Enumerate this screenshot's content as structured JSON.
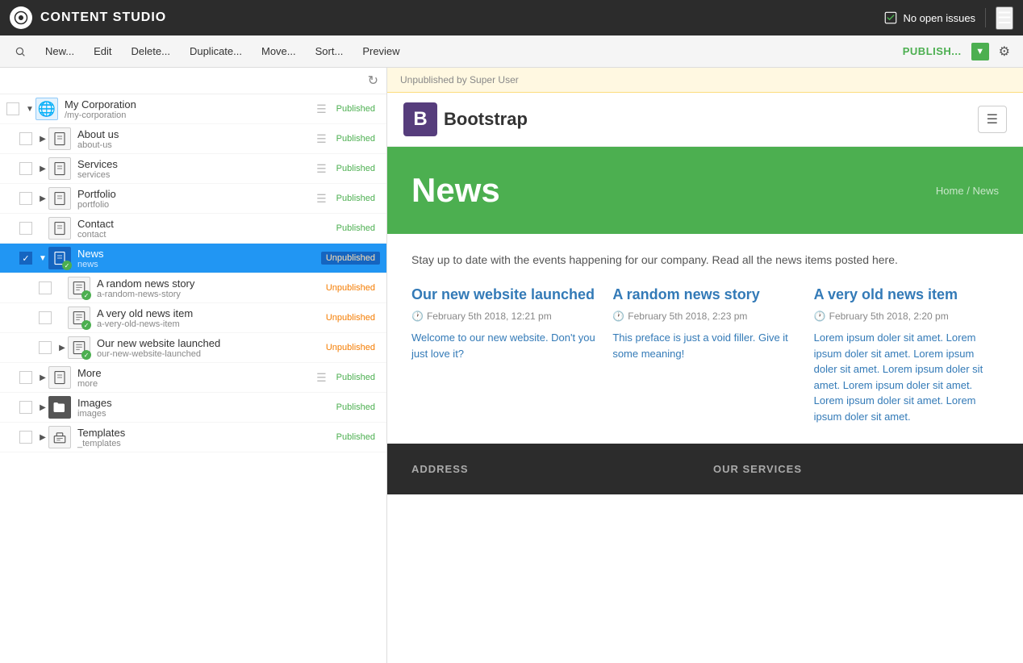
{
  "topbar": {
    "title": "CONTENT STUDIO",
    "no_issues_label": "No open issues"
  },
  "toolbar": {
    "new_label": "New...",
    "edit_label": "Edit",
    "delete_label": "Delete...",
    "duplicate_label": "Duplicate...",
    "move_label": "Move...",
    "sort_label": "Sort...",
    "preview_label": "Preview",
    "publish_label": "PUBLISH..."
  },
  "sidebar": {
    "items": [
      {
        "id": "my-corporation",
        "name": "My Corporation",
        "path": "/my-corporation",
        "icon": "globe",
        "status": "Published",
        "status_class": "published",
        "indent": 0,
        "has_expand": true,
        "expanded": true
      },
      {
        "id": "about-us",
        "name": "About us",
        "path": "about-us",
        "icon": "page",
        "status": "Published",
        "status_class": "published",
        "indent": 1,
        "has_expand": true
      },
      {
        "id": "services",
        "name": "Services",
        "path": "services",
        "icon": "page",
        "status": "Published",
        "status_class": "published",
        "indent": 1,
        "has_expand": true
      },
      {
        "id": "portfolio",
        "name": "Portfolio",
        "path": "portfolio",
        "icon": "page",
        "status": "Published",
        "status_class": "published",
        "indent": 1,
        "has_expand": true
      },
      {
        "id": "contact",
        "name": "Contact",
        "path": "contact",
        "icon": "page",
        "status": "Published",
        "status_class": "published",
        "indent": 1,
        "has_expand": false
      },
      {
        "id": "news",
        "name": "News",
        "path": "news",
        "icon": "page",
        "status": "Unpublished",
        "status_class": "unpublished",
        "indent": 1,
        "has_expand": true,
        "selected": true
      },
      {
        "id": "a-random-news-story",
        "name": "A random news story",
        "path": "a-random-news-story",
        "icon": "article",
        "status": "Unpublished",
        "status_class": "unpublished",
        "indent": 2,
        "has_expand": false,
        "has_check": true
      },
      {
        "id": "a-very-old-news-item",
        "name": "A very old news item",
        "path": "a-very-old-news-item",
        "icon": "article",
        "status": "Unpublished",
        "status_class": "unpublished",
        "indent": 2,
        "has_expand": false,
        "has_check": true
      },
      {
        "id": "our-new-website-launched",
        "name": "Our new website launched",
        "path": "our-new-website-launched",
        "icon": "article",
        "status": "Unpublished",
        "status_class": "unpublished",
        "indent": 2,
        "has_expand": true,
        "has_check": true
      },
      {
        "id": "more",
        "name": "More",
        "path": "more",
        "icon": "page",
        "status": "Published",
        "status_class": "published",
        "indent": 1,
        "has_expand": true
      },
      {
        "id": "images",
        "name": "Images",
        "path": "images",
        "icon": "folder",
        "status": "Published",
        "status_class": "published",
        "indent": 1,
        "has_expand": true
      },
      {
        "id": "templates",
        "name": "Templates",
        "path": "_templates",
        "icon": "templates",
        "status": "Published",
        "status_class": "published",
        "indent": 1,
        "has_expand": true
      }
    ]
  },
  "preview": {
    "unpublished_by": "Unpublished by Super User",
    "brand_letter": "B",
    "brand_name": "Bootstrap",
    "hero_title": "News",
    "breadcrumb_home": "Home",
    "breadcrumb_sep": "/",
    "breadcrumb_current": "News",
    "intro_text": "Stay up to date with the events happening for our company. Read all the news items posted here.",
    "cards": [
      {
        "title": "Our new website launched",
        "date": "February 5th 2018, 12:21 pm",
        "text": "Welcome to our new website. Don't you just love it?",
        "text_color": "blue"
      },
      {
        "title": "A random news story",
        "date": "February 5th 2018, 2:23 pm",
        "text": "This preface is just a void filler. Give it some meaning!",
        "text_color": "blue"
      },
      {
        "title": "A very old news item",
        "date": "February 5th 2018, 2:20 pm",
        "text": "Lorem ipsum doler sit amet. Lorem ipsum doler sit amet. Lorem ipsum doler sit amet. Lorem ipsum doler sit amet. Lorem ipsum doler sit amet. Lorem ipsum doler sit amet. Lorem ipsum doler sit amet.",
        "text_color": "blue"
      }
    ],
    "footer": {
      "col1_heading": "ADDRESS",
      "col2_heading": "OUR SERVICES"
    }
  }
}
